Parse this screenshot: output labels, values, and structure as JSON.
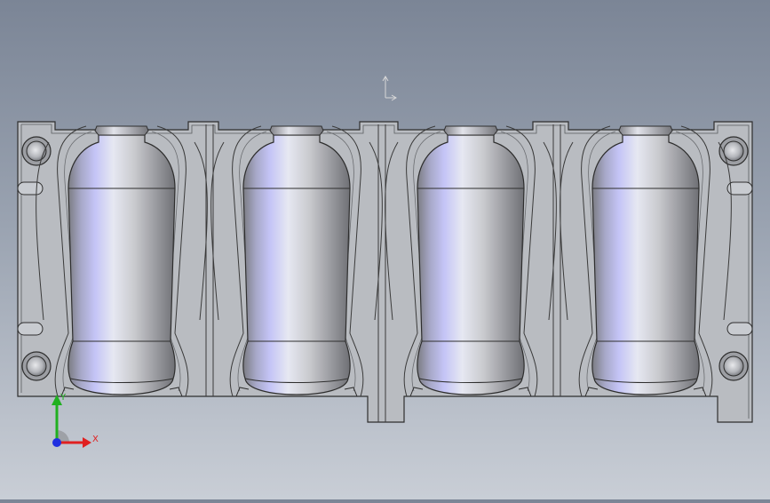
{
  "viewport": {
    "triad": {
      "x_label": "X",
      "y_label": "Y",
      "x_color": "#e02020",
      "y_color": "#20b020",
      "z_color": "#2030e0"
    },
    "origin_indicator": "origin-axis-icon",
    "model": {
      "cavity_count": 4,
      "colors": {
        "mold_face": "#b9bcc1",
        "mold_edge": "#3a3a3a",
        "bottle_mid": "#e4e6f3",
        "bottle_shadow": "#6f7075",
        "bottle_highlight": "#b7b8ff"
      }
    }
  }
}
